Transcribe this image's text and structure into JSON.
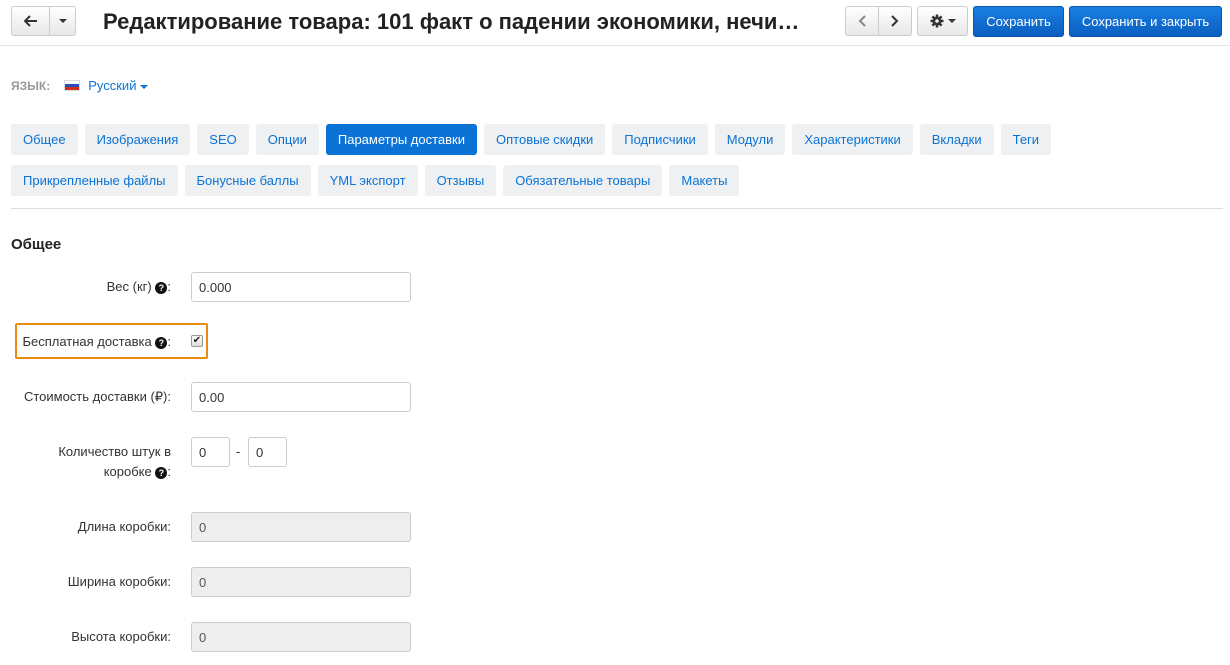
{
  "header": {
    "title": "Редактирование товара: 101 факт о падении экономики, нечи…",
    "save_label": "Сохранить",
    "save_close_label": "Сохранить и закрыть"
  },
  "language": {
    "label": "ЯЗЫК:",
    "selected": "Русский"
  },
  "tabs": [
    {
      "label": "Общее",
      "active": false
    },
    {
      "label": "Изображения",
      "active": false
    },
    {
      "label": "SEO",
      "active": false
    },
    {
      "label": "Опции",
      "active": false
    },
    {
      "label": "Параметры доставки",
      "active": true
    },
    {
      "label": "Оптовые скидки",
      "active": false
    },
    {
      "label": "Подписчики",
      "active": false
    },
    {
      "label": "Модули",
      "active": false
    },
    {
      "label": "Характеристики",
      "active": false
    },
    {
      "label": "Вкладки",
      "active": false
    },
    {
      "label": "Теги",
      "active": false
    },
    {
      "label": "Прикрепленные файлы",
      "active": false
    },
    {
      "label": "Бонусные баллы",
      "active": false
    },
    {
      "label": "YML экспорт",
      "active": false
    },
    {
      "label": "Отзывы",
      "active": false
    },
    {
      "label": "Обязательные товары",
      "active": false
    },
    {
      "label": "Макеты",
      "active": false
    }
  ],
  "form": {
    "section_title": "Общее",
    "weight": {
      "label": "Вес (кг)",
      "value": "0.000"
    },
    "free_delivery": {
      "label": "Бесплатная доставка",
      "checked": true
    },
    "delivery_cost": {
      "label": "Стоимость доставки (₽):",
      "value": "0.00"
    },
    "box_qty": {
      "label_line1": "Количество штук в",
      "label_line2": "коробке",
      "from": "0",
      "to": "0",
      "separator": "-"
    },
    "box_length": {
      "label": "Длина коробки:",
      "value": "0"
    },
    "box_width": {
      "label": "Ширина коробки:",
      "value": "0"
    },
    "box_height": {
      "label": "Высота коробки:",
      "value": "0"
    }
  },
  "colors": {
    "accent": "#0b73d6",
    "highlight": "#e88a14"
  }
}
